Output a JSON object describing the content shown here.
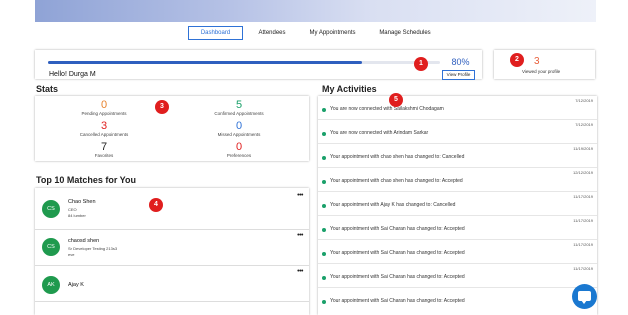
{
  "nav": {
    "tabs": [
      {
        "label": "Dashboard",
        "active": true
      },
      {
        "label": "Attendees"
      },
      {
        "label": "My Appointments"
      },
      {
        "label": "Manage Schedules"
      }
    ]
  },
  "profile": {
    "greeting": "Hello! Durga M",
    "progress_percent_text": "80%",
    "progress_fraction": 0.8,
    "view_profile_label": "View Profile"
  },
  "viewed": {
    "count": "3",
    "label": "Viewed your profile"
  },
  "annotations": [
    "1",
    "2",
    "3",
    "4",
    "5"
  ],
  "stats": {
    "title": "Stats",
    "items": [
      {
        "value": "0",
        "label": "Pending Appointments",
        "color": "#e8822c"
      },
      {
        "value": "5",
        "label": "Confirmed Appointments",
        "color": "#1aa06a"
      },
      {
        "value": "3",
        "label": "Cancelled Appointments",
        "color": "#e02020"
      },
      {
        "value": "0",
        "label": "Missed Appointments",
        "color": "#2f72d6"
      },
      {
        "value": "7",
        "label": "Favorites",
        "color": "#222222"
      },
      {
        "value": "0",
        "label": "Preferences",
        "color": "#e02020"
      }
    ]
  },
  "matches": {
    "title": "Top 10 Matches for You",
    "items": [
      {
        "initials": "CS",
        "name": "Chao Shen",
        "line1": "CEO",
        "line2": "84 lumber"
      },
      {
        "initials": "CS",
        "name": "chaosd shen",
        "line1": "Sr Developer Testing 213s3",
        "line2": "eve"
      },
      {
        "initials": "AK",
        "name": "Ajay K",
        "line1": "",
        "line2": ""
      }
    ],
    "more_glyph": "•••",
    "avatar_color": "#1f9a4e"
  },
  "activities": {
    "title": "My Activities",
    "items": [
      {
        "text": "You are now connected with Sailakshmi Chodagam",
        "date": "7/12/2019"
      },
      {
        "text": "You are now connected with Arindam Sarkar",
        "date": "7/12/2019"
      },
      {
        "text": "Your appointment with chao shen has changed to: Cancelled",
        "date": "11/19/2019"
      },
      {
        "text": "Your appointment with chao shen has changed to: Accepted",
        "date": "12/12/2019"
      },
      {
        "text": "Your appointment with Ajay K has changed to: Cancelled",
        "date": "11/17/2019"
      },
      {
        "text": "Your appointment with Sai Charan has changed to: Accepted",
        "date": "11/17/2019"
      },
      {
        "text": "Your appointment with Sai Charan has changed to: Accepted",
        "date": "11/17/2019"
      },
      {
        "text": "Your appointment with Sai Charan has changed to: Accepted",
        "date": "11/17/2019"
      },
      {
        "text": "Your appointment with Sai Charan has changed to: Accepted",
        "date": "11/17/2019"
      }
    ],
    "dot_color": "#1aa06a"
  },
  "colors": {
    "accent": "#2f72d6",
    "progress": "#2f5fbf",
    "badge": "#e01e1e",
    "chat": "#1a78d0"
  },
  "icons": {
    "chat": "chat-bubble-icon",
    "more": "more-horizontal-icon"
  }
}
